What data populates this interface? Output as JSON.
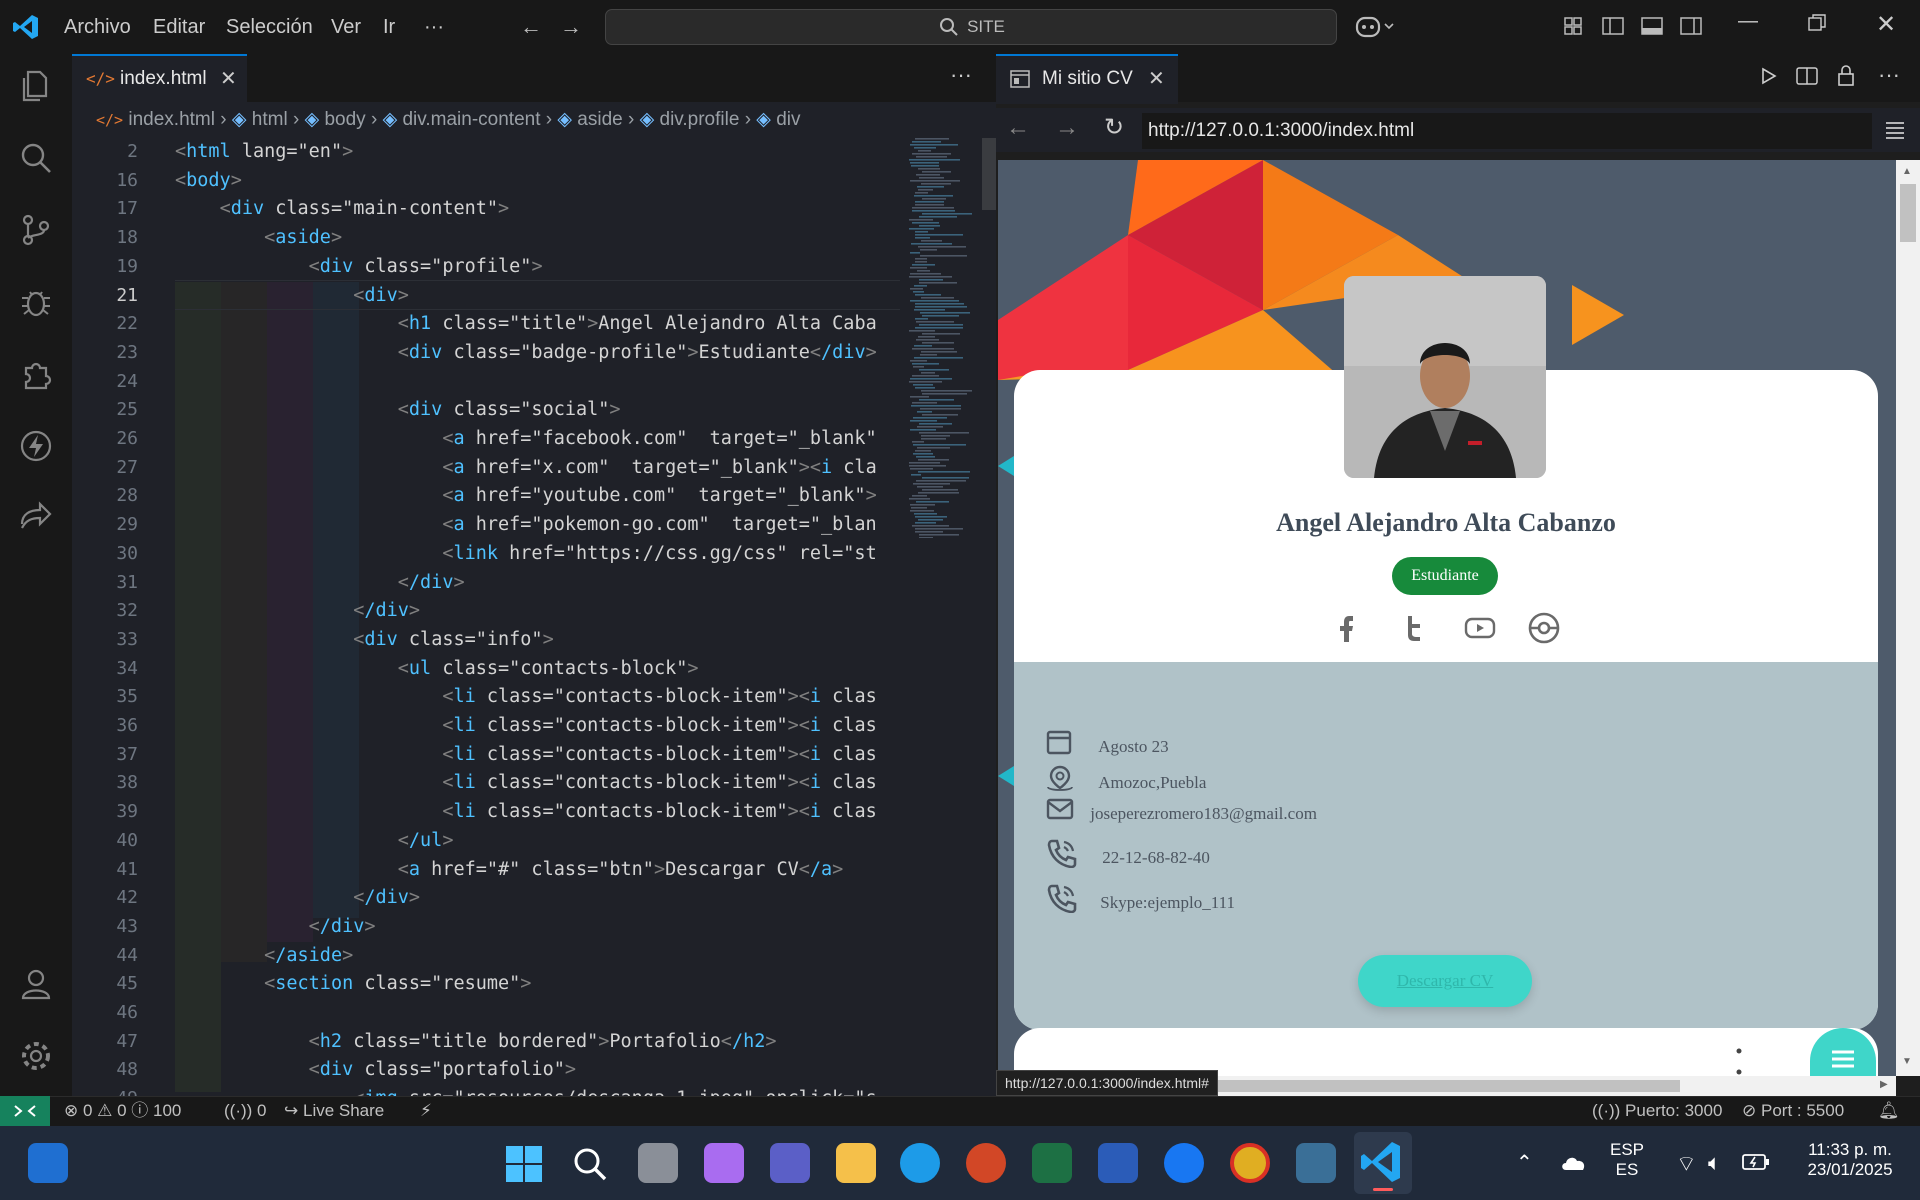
{
  "titlebar": {
    "menus": [
      "Archivo",
      "Editar",
      "Selección",
      "Ver",
      "Ir",
      "···"
    ],
    "search": "SITE"
  },
  "editor": {
    "tab_label": "index.html",
    "breadcrumb": [
      "index.html",
      "html",
      "body",
      "div.main-content",
      "aside",
      "div.profile",
      "div"
    ],
    "line_numbers": [
      "2",
      "16",
      "17",
      "18",
      "19",
      "21",
      "22",
      "23",
      "24",
      "25",
      "26",
      "27",
      "28",
      "29",
      "30",
      "31",
      "32",
      "33",
      "34",
      "35",
      "36",
      "37",
      "38",
      "39",
      "40",
      "41",
      "42",
      "43",
      "44",
      "45",
      "46",
      "47",
      "48",
      "49"
    ],
    "code_lines": [
      "<html lang=\"en\">",
      "<body>",
      "    <div class=\"main-content\">",
      "        <aside>",
      "            <div class=\"profile\">",
      "                <div>",
      "                    <h1 class=\"title\">Angel Alejandro Alta Caba",
      "                    <div class=\"badge-profile\">Estudiante</div>",
      "",
      "                    <div class=\"social\">",
      "                        <a href=\"facebook.com\"  target=\"_blank\"",
      "                        <a href=\"x.com\"  target=\"_blank\"><i cla",
      "                        <a href=\"youtube.com\"  target=\"_blank\">",
      "                        <a href=\"pokemon-go.com\"  target=\"_blan",
      "                        <link href=\"https://css.gg/css\" rel=\"st",
      "                    </div>",
      "                </div>",
      "                <div class=\"info\">",
      "                    <ul class=\"contacts-block\">",
      "                        <li class=\"contacts-block-item\"><i clas",
      "                        <li class=\"contacts-block-item\"><i clas",
      "                        <li class=\"contacts-block-item\"><i clas",
      "                        <li class=\"contacts-block-item\"><i clas",
      "                        <li class=\"contacts-block-item\"><i clas",
      "                    </ul>",
      "                    <a href=\"#\" class=\"btn\">Descargar CV</a>",
      "                </div>",
      "            </div>",
      "        </aside>",
      "        <section class=\"resume\">",
      "",
      "            <h2 class=\"title bordered\">Portafolio</h2>",
      "            <div class=\"portafolio\">",
      "                <img src=\"resources/descanga 1.jpeg\" onclick=\"s"
    ]
  },
  "preview": {
    "tab_label": "Mi sitio CV",
    "url": "http://127.0.0.1:3000/index.html",
    "status_link": "http://127.0.0.1:3000/index.html#",
    "profile": {
      "name": "Angel Alejandro Alta Cabanzo",
      "badge": "Estudiante",
      "social_icons": [
        "facebook-icon",
        "twitter-icon",
        "youtube-icon",
        "pokemon-icon"
      ],
      "contacts": [
        {
          "icon": "calendar-icon",
          "text": "Agosto 23"
        },
        {
          "icon": "location-icon",
          "text": "Amozoc,Puebla"
        },
        {
          "icon": "mail-icon",
          "text": "joseperezromero183@gmail.com"
        },
        {
          "icon": "phone-icon",
          "text": "22-12-68-82-40"
        },
        {
          "icon": "phone-icon",
          "text": "Skype:ejemplo_111"
        }
      ],
      "button": "Descargar CV"
    }
  },
  "statusbar": {
    "problems": "⊗ 0 ⚠ 0 ⓘ 100",
    "ports": "0",
    "live_share": "Live Share",
    "puerto": "Puerto: 3000",
    "port": "Port : 5500"
  },
  "taskbar": {
    "lang1": "ESP",
    "lang2": "ES",
    "time": "11:33 p. m.",
    "date": "23/01/2025"
  },
  "colors": {
    "accent": "#0078d4",
    "badge": "#178a3b",
    "button": "#3fd6c9"
  }
}
